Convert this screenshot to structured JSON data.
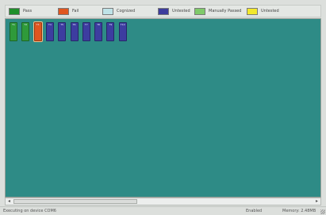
{
  "legend": [
    {
      "label": "Pass",
      "color": "#1f8f2b"
    },
    {
      "label": "Fail",
      "color": "#e0561f"
    },
    {
      "label": "Cognized",
      "color": "#bfe3e8"
    },
    {
      "label": "Untested",
      "color": "#3d3d9c"
    },
    {
      "label": "Manually Passed",
      "color": "#7fca6a"
    },
    {
      "label": "Untested",
      "color": "#f2e82c"
    }
  ],
  "nodes": [
    {
      "status": "pass",
      "color": "#2f9a3a",
      "label": "T1"
    },
    {
      "status": "pass",
      "color": "#2f9a3a",
      "label": "T2"
    },
    {
      "status": "fail",
      "color": "#e0561f",
      "label": "T3"
    },
    {
      "status": "untested",
      "color": "#3d3da0",
      "label": "T4"
    },
    {
      "status": "untested",
      "color": "#3d3da0",
      "label": "T5"
    },
    {
      "status": "untested",
      "color": "#3d3da0",
      "label": "T6"
    },
    {
      "status": "untested",
      "color": "#3d3da0",
      "label": "T7"
    },
    {
      "status": "untested",
      "color": "#3d3da0",
      "label": "T8"
    },
    {
      "status": "untested",
      "color": "#3d3da0",
      "label": "T9"
    },
    {
      "status": "untested",
      "color": "#3d3da0",
      "label": "T10"
    }
  ],
  "canvas": {
    "background": "#2e8b86"
  },
  "statusbar": {
    "left": "Executing on device COM6",
    "middle": "Enabled",
    "right": "Memory: 2.48MB"
  }
}
